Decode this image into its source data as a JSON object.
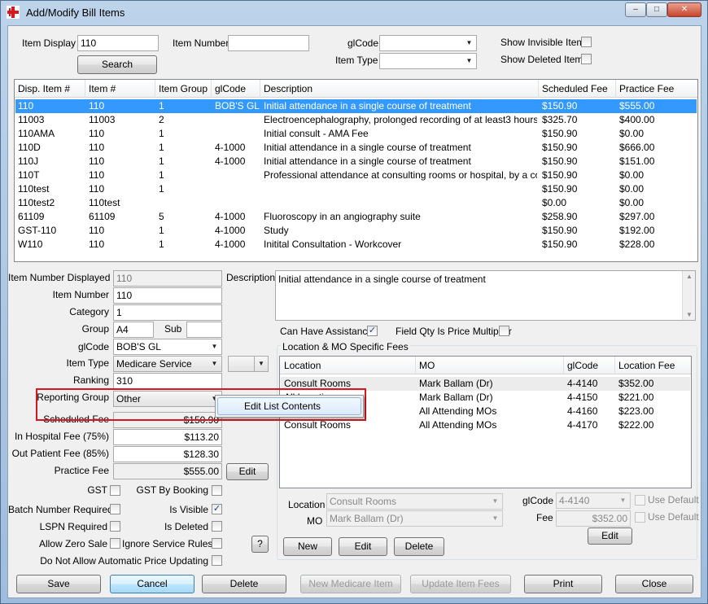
{
  "window": {
    "title": "Add/Modify Bill Items",
    "min": "–",
    "max": "□",
    "close": "✕"
  },
  "search": {
    "item_display_label": "Item Display",
    "item_display_value": "110",
    "item_number_label": "Item Number",
    "item_number_value": "",
    "glcode_label": "glCode",
    "glcode_value": "",
    "item_type_label": "Item Type",
    "item_type_value": "",
    "search_button": "Search",
    "show_invisible_label": "Show Invisible Items",
    "show_deleted_label": "Show Deleted Items",
    "show_invisible_checked": false,
    "show_deleted_checked": false
  },
  "items_table": {
    "headers": [
      "Disp. Item #",
      "Item #",
      "Item Group",
      "glCode",
      "Description",
      "Scheduled Fee",
      "Practice Fee"
    ],
    "rows": [
      [
        "110",
        "110",
        "1",
        "BOB'S GL",
        "Initial attendance in a single course of treatment",
        "$150.90",
        "$555.00"
      ],
      [
        "11003",
        "11003",
        "2",
        "",
        "Electroencephalography, prolonged recording of at least3 hours dur...",
        "$325.70",
        "$400.00"
      ],
      [
        "110AMA",
        "110",
        "1",
        "",
        "Initial consult - AMA Fee",
        "$150.90",
        "$0.00"
      ],
      [
        "110D",
        "110",
        "1",
        "4-1000",
        "Initial attendance in a single course of treatment",
        "$150.90",
        "$666.00"
      ],
      [
        "110J",
        "110",
        "1",
        "4-1000",
        "Initial attendance in a single course of treatment",
        "$150.90",
        "$151.00"
      ],
      [
        "110T",
        "110",
        "1",
        "",
        "Professional attendance at consulting rooms or hospital, by a consul...",
        "$150.90",
        "$0.00"
      ],
      [
        "110test",
        "110",
        "1",
        "",
        "",
        "$150.90",
        "$0.00"
      ],
      [
        "110test2",
        "110test",
        "",
        "",
        "",
        "$0.00",
        "$0.00"
      ],
      [
        "61109",
        "61109",
        "5",
        "4-1000",
        "Fluoroscopy in an angiography suite",
        "$258.90",
        "$297.00"
      ],
      [
        "GST-110",
        "110",
        "1",
        "4-1000",
        "Study",
        "$150.90",
        "$192.00"
      ],
      [
        "W110",
        "110",
        "1",
        "4-1000",
        "Initital Consultation - Workcover",
        "$150.90",
        "$228.00"
      ]
    ],
    "selected_row": 0
  },
  "detail": {
    "item_number_displayed_label": "Item Number Displayed",
    "item_number_displayed": "110",
    "item_number_label": "Item Number",
    "item_number": "110",
    "category_label": "Category",
    "category": "1",
    "group_label": "Group",
    "group": "A4",
    "sub_label": "Sub",
    "sub": "",
    "glcode_label": "glCode",
    "glcode": "BOB'S GL",
    "item_type_label": "Item Type",
    "item_type": "Medicare Service",
    "item_type_extra": "",
    "ranking_label": "Ranking",
    "ranking": "310",
    "reporting_group_label": "Reporting Group",
    "reporting_group": "Other",
    "scheduled_fee_label": "Scheduled Fee",
    "scheduled_fee": "$150.90",
    "in_hospital_fee_label": "In Hospital Fee (75%)",
    "in_hospital_fee": "$113.20",
    "out_patient_fee_label": "Out Patient Fee (85%)",
    "out_patient_fee": "$128.30",
    "practice_fee_label": "Practice Fee",
    "practice_fee": "$555.00",
    "practice_fee_edit": "Edit",
    "gst_label": "GST",
    "gst_by_booking_label": "GST By Booking",
    "batch_number_label": "Batch Number Required",
    "is_visible_label": "Is Visible",
    "lspn_label": "LSPN Required",
    "is_deleted_label": "Is Deleted",
    "allow_zero_label": "Allow Zero Sale",
    "ignore_rules_label": "Ignore Service Rules",
    "no_auto_price_label": "Do Not Allow Automatic Price Updating",
    "help_button": "?",
    "description_label": "Description",
    "description": "Initial attendance in a single course of treatment",
    "can_have_assistance_label": "Can Have Assistance",
    "field_qty_label": "Field Qty Is Price Multiplier",
    "checks": {
      "gst": false,
      "gst_by_booking": false,
      "batch": false,
      "is_visible": true,
      "lspn": false,
      "is_deleted": false,
      "allow_zero": false,
      "ignore_rules": false,
      "no_auto_price": false,
      "can_have_assistance": true,
      "field_qty": false
    }
  },
  "context_menu": {
    "item": "Edit List Contents"
  },
  "location_fees": {
    "title": "Location & MO Specific Fees",
    "headers": [
      "Location",
      "MO",
      "glCode",
      "Location Fee"
    ],
    "rows": [
      [
        "Consult Rooms",
        "Mark Ballam (Dr)",
        "4-4140",
        "$352.00"
      ],
      [
        "All Locations",
        "Mark Ballam (Dr)",
        "4-4150",
        "$221.00"
      ],
      [
        "All Locations",
        "All Attending MOs",
        "4-4160",
        "$223.00"
      ],
      [
        "Consult Rooms",
        "All Attending MOs",
        "4-4170",
        "$222.00"
      ]
    ],
    "location_label": "Location",
    "location_value": "Consult Rooms",
    "mo_label": "MO",
    "mo_value": "Mark Ballam (Dr)",
    "glcode_label": "glCode",
    "glcode_value": "4-4140",
    "fee_label": "Fee",
    "fee_value": "$352.00",
    "use_default_label": "Use Default",
    "edit_button": "Edit",
    "new_button": "New",
    "edit2_button": "Edit",
    "delete_button": "Delete"
  },
  "footer": {
    "save": "Save",
    "cancel": "Cancel",
    "delete": "Delete",
    "new_medicare": "New Medicare Item",
    "update_fees": "Update Item Fees",
    "print": "Print",
    "close": "Close"
  },
  "colors": {
    "selection": "#3399ff",
    "highlight_box": "#d9161e",
    "title_bar": "#b4cde6"
  }
}
